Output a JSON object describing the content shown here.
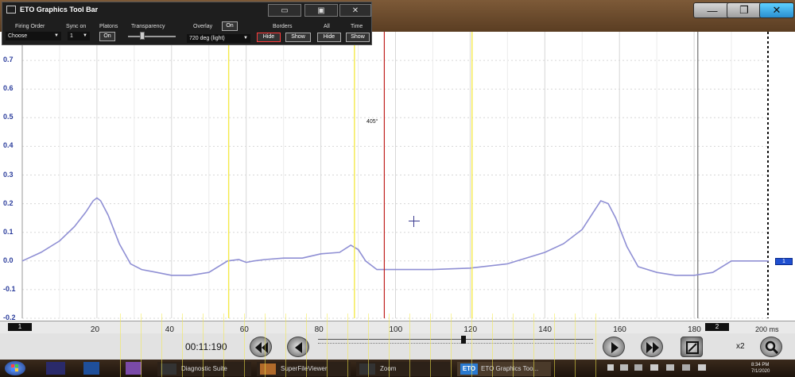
{
  "toolbar": {
    "title": "ETO Graphics Tool Bar",
    "firing_order_label": "Firing Order",
    "firing_order_value": "Choose",
    "sync_on_label": "Sync on",
    "sync_on_value": "1",
    "platons_label": "Platons",
    "platons_button": "On",
    "transparency_label": "Transparency",
    "overlay_label": "Overlay",
    "overlay_button": "On",
    "overlay_value": "720 deg (light)",
    "borders_label": "Borders",
    "borders_hide": "Hide",
    "borders_show": "Show",
    "all_label": "All",
    "all_hide": "Hide",
    "time_label": "Time",
    "time_show": "Show",
    "transparency_level": 0.3
  },
  "annotation": "405°",
  "controls": {
    "timecode": "00:11:190",
    "zoom": "x2",
    "scrub_position": 0.53
  },
  "taskbar": {
    "items": [
      "Diagnostic Suite",
      "SuperFileViewer",
      "Zoom",
      "ETO Graphics Too..."
    ],
    "clock_time": "8:34 PM",
    "clock_date": "7/1/2020"
  },
  "markers": {
    "left": "1",
    "right": "2",
    "channel": "1"
  },
  "chart_data": {
    "type": "line",
    "title": "",
    "xlabel": "",
    "ylabel": "",
    "x_unit_label": "200 ms",
    "xlim": [
      0,
      200
    ],
    "ylim": [
      -0.2,
      0.8
    ],
    "x_ticks": [
      20,
      40,
      60,
      80,
      100,
      120,
      140,
      160,
      180
    ],
    "y_ticks": [
      -0.2,
      -0.1,
      0.0,
      0.1,
      0.2,
      0.3,
      0.4,
      0.5,
      0.6,
      0.7
    ],
    "y_tick_labels": [
      "-0.2",
      "-0.1",
      "0.0",
      "0.1",
      "0.2",
      "0.3",
      "0.4",
      "0.5",
      "0.6",
      "0.7"
    ],
    "series": [
      {
        "color": "#8f8fd4",
        "x": [
          0,
          5,
          10,
          14,
          17,
          19,
          20,
          21,
          23,
          26,
          29,
          32,
          36,
          40,
          45,
          50,
          55,
          58,
          60,
          62,
          65,
          70,
          75,
          80,
          85,
          88,
          90,
          92,
          95,
          100,
          110,
          120,
          130,
          140,
          145,
          150,
          153,
          155,
          157,
          159,
          162,
          165,
          170,
          175,
          180,
          185,
          190,
          195,
          200
        ],
        "y": [
          0.0,
          0.03,
          0.07,
          0.12,
          0.17,
          0.21,
          0.22,
          0.21,
          0.16,
          0.06,
          -0.01,
          -0.03,
          -0.04,
          -0.05,
          -0.05,
          -0.04,
          0.0,
          0.005,
          -0.005,
          0.0,
          0.005,
          0.01,
          0.01,
          0.025,
          0.03,
          0.055,
          0.04,
          0.0,
          -0.03,
          -0.03,
          -0.03,
          -0.025,
          -0.01,
          0.03,
          0.06,
          0.11,
          0.17,
          0.21,
          0.2,
          0.15,
          0.05,
          -0.02,
          -0.04,
          -0.05,
          -0.05,
          -0.04,
          0.0,
          0.0,
          0.0
        ]
      }
    ],
    "grid": true
  },
  "colors": {
    "yellow_cursor": "#f4e94a",
    "red_cursor": "#c0201e",
    "trace": "#8f8fd4",
    "grid": "#d7d7d7",
    "axis_label": "#2b3d9c"
  }
}
